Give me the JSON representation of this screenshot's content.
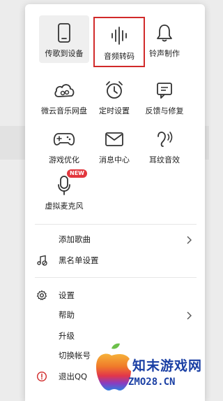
{
  "grid": {
    "items": [
      {
        "label": "传歌到设备",
        "icon": "phone-icon"
      },
      {
        "label": "音频转码",
        "icon": "audio-wave-icon"
      },
      {
        "label": "铃声制作",
        "icon": "bell-icon"
      },
      {
        "label": "微云音乐网盘",
        "icon": "cloud-music-icon"
      },
      {
        "label": "定时设置",
        "icon": "alarm-clock-icon"
      },
      {
        "label": "反馈与修复",
        "icon": "feedback-icon"
      },
      {
        "label": "游戏优化",
        "icon": "gamepad-icon"
      },
      {
        "label": "消息中心",
        "icon": "mail-icon"
      },
      {
        "label": "耳纹音效",
        "icon": "ear-icon"
      },
      {
        "label": "虚拟麦克风",
        "icon": "microphone-icon",
        "badge": "NEW"
      }
    ]
  },
  "list": {
    "add_song": "添加歌曲",
    "blacklist": "黑名单设置",
    "settings": "设置",
    "help": "帮助",
    "upgrade": "升级",
    "switch_account": "切换帐号",
    "logout": "退出QQ"
  },
  "watermark": {
    "line1": "知末游戏网",
    "line2": "ZMO28.CN"
  },
  "colors": {
    "highlight_box": "#d12a2a",
    "badge": "#e2363d"
  }
}
